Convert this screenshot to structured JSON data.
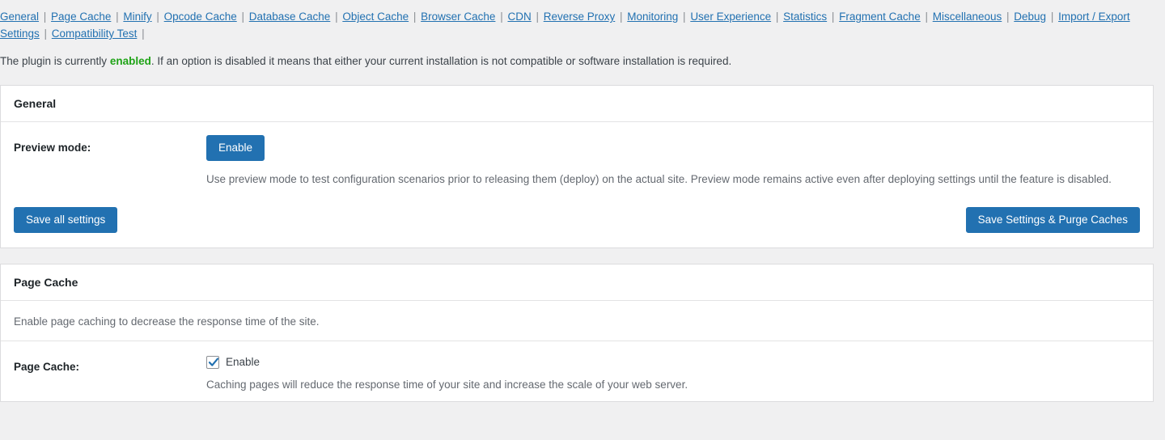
{
  "nav": {
    "separator": "|",
    "items": [
      {
        "label": "General"
      },
      {
        "label": "Page Cache"
      },
      {
        "label": "Minify"
      },
      {
        "label": "Opcode Cache"
      },
      {
        "label": "Database Cache"
      },
      {
        "label": "Object Cache"
      },
      {
        "label": "Browser Cache"
      },
      {
        "label": "CDN"
      },
      {
        "label": "Reverse Proxy"
      },
      {
        "label": "Monitoring"
      },
      {
        "label": "User Experience"
      },
      {
        "label": "Statistics"
      },
      {
        "label": "Fragment Cache"
      },
      {
        "label": "Miscellaneous"
      },
      {
        "label": "Debug"
      },
      {
        "label": "Import / Export Settings"
      },
      {
        "label": "Compatibility Test"
      }
    ]
  },
  "status": {
    "prefix": "The plugin is currently ",
    "state": "enabled",
    "suffix": ". If an option is disabled it means that either your current installation is not compatible or software installation is required.",
    "state_color": "#1fa317"
  },
  "general_panel": {
    "title": "General",
    "preview_mode": {
      "label": "Preview mode:",
      "button_label": "Enable",
      "description": "Use preview mode to test configuration scenarios prior to releasing them (deploy) on the actual site. Preview mode remains active even after deploying settings until the feature is disabled."
    },
    "submit": {
      "save_all_label": "Save all settings",
      "save_purge_label": "Save Settings & Purge Caches"
    }
  },
  "page_cache_panel": {
    "title": "Page Cache",
    "note": "Enable page caching to decrease the response time of the site.",
    "page_cache": {
      "label": "Page Cache:",
      "checkbox_label": "Enable",
      "checked": true,
      "description": "Caching pages will reduce the response time of your site and increase the scale of your web server."
    }
  },
  "theme": {
    "accent": "#2271b1",
    "link": "#2271b1",
    "page_bg": "#f0f0f1",
    "panel_bg": "#ffffff",
    "border": "#dcdcde"
  }
}
